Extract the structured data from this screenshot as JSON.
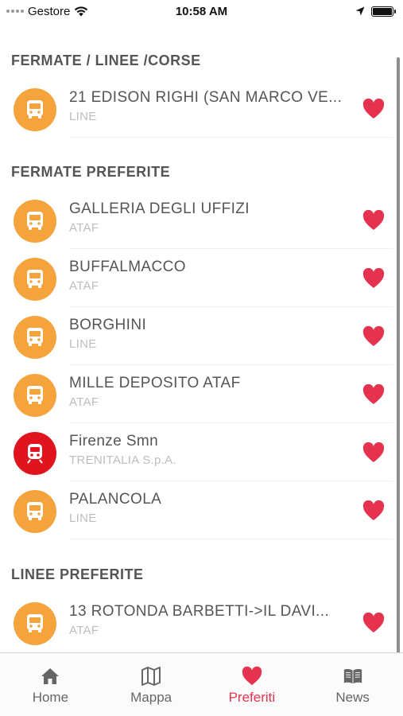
{
  "status_bar": {
    "carrier": "Gestore",
    "time": "10:58 AM"
  },
  "sections": {
    "lines_trips": "FERMATE / LINEE /CORSE",
    "favorite_stops": "FERMATE  PREFERITE",
    "favorite_lines": "LINEE PREFERITE"
  },
  "lines_trips_items": [
    {
      "title": "21 EDISON RIGHI (SAN MARCO VE...",
      "subtitle": "LINE",
      "type": "bus"
    }
  ],
  "favorite_stops_items": [
    {
      "title": "GALLERIA DEGLI UFFIZI",
      "subtitle": "ATAF",
      "type": "bus"
    },
    {
      "title": "BUFFALMACCO",
      "subtitle": "ATAF",
      "type": "bus"
    },
    {
      "title": "BORGHINI",
      "subtitle": "LINE",
      "type": "bus"
    },
    {
      "title": "MILLE DEPOSITO ATAF",
      "subtitle": "ATAF",
      "type": "bus"
    },
    {
      "title": "Firenze Smn",
      "subtitle": "TRENITALIA S.p.A.",
      "type": "train"
    },
    {
      "title": "PALANCOLA",
      "subtitle": "LINE",
      "type": "bus"
    }
  ],
  "favorite_lines_items": [
    {
      "title": "13 ROTONDA BARBETTI->IL DAVI...",
      "subtitle": "ATAF",
      "type": "bus"
    }
  ],
  "tabs": [
    {
      "label": "Home",
      "icon": "home-icon",
      "active": false
    },
    {
      "label": "Mappa",
      "icon": "map-icon",
      "active": false
    },
    {
      "label": "Preferiti",
      "icon": "heart-icon",
      "active": true
    },
    {
      "label": "News",
      "icon": "book-icon",
      "active": false
    }
  ],
  "colors": {
    "bus_icon": "#f5a33c",
    "train_icon": "#e0141e",
    "heart": "#e5334f",
    "active_tab": "#e5334f"
  }
}
